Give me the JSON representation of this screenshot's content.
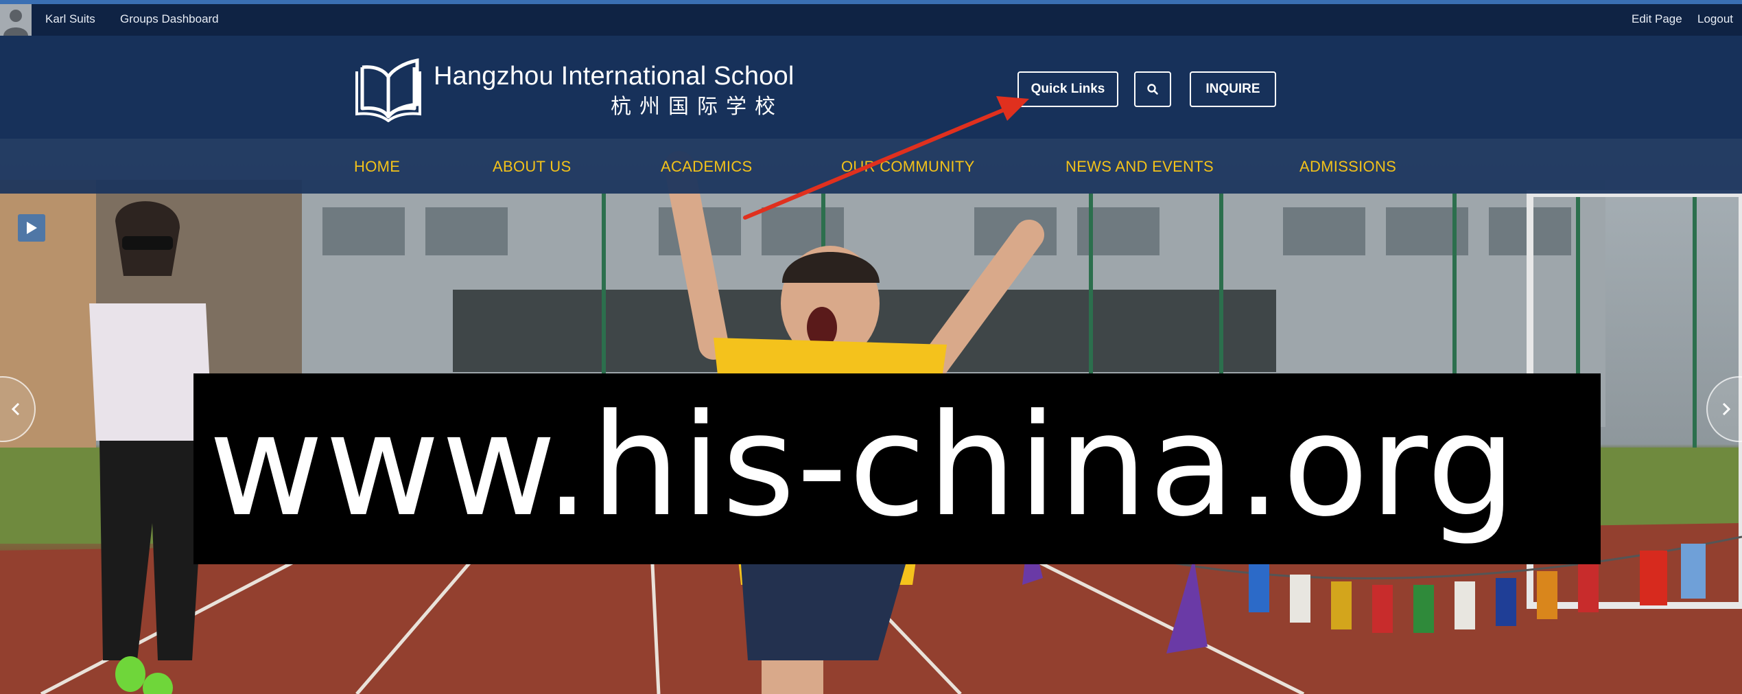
{
  "admin_bar": {
    "user_name": "Karl  Suits",
    "groups_dashboard": "Groups Dashboard",
    "edit_page": "Edit Page",
    "logout": "Logout"
  },
  "header": {
    "school_name": "Hangzhou International School",
    "school_name_cn": "杭州国际学校",
    "quick_links_label": "Quick Links",
    "search_icon": "search-icon",
    "inquire_label": "INQUIRE"
  },
  "nav": {
    "items": [
      "HOME",
      "ABOUT US",
      "ACADEMICS",
      "OUR COMMUNITY",
      "NEWS AND EVENTS",
      "ADMISSIONS"
    ]
  },
  "hero": {
    "play_icon": "play-icon",
    "prev_icon": "chevron-left-icon",
    "next_icon": "chevron-right-icon"
  },
  "overlay": {
    "url_text": "www.his-china.org"
  },
  "colors": {
    "admin_bar_bg": "#0f2344",
    "header_bg": "#17315a",
    "nav_text": "#f3c21a",
    "annotation_arrow": "#e0301e",
    "banner_bg": "#000000"
  }
}
